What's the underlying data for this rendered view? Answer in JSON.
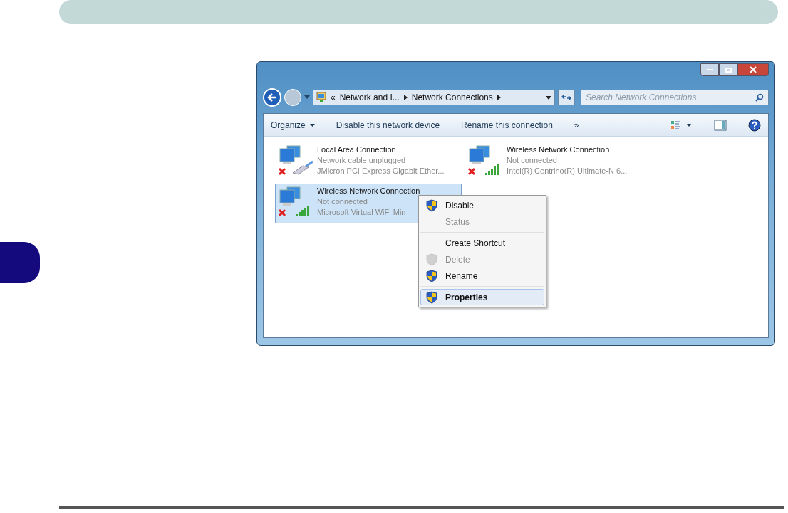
{
  "window": {
    "nav": {
      "breadcrumb": [
        "«",
        "Network and I...",
        "Network Connections"
      ]
    },
    "search": {
      "placeholder": "Search Network Connections"
    },
    "toolbar": [
      {
        "label": "Organize",
        "kind": "menu"
      },
      {
        "label": "Disable this network device",
        "kind": "plain"
      },
      {
        "label": "Rename this connection",
        "kind": "plain"
      },
      {
        "label": "»",
        "kind": "plain"
      }
    ],
    "connections": [
      {
        "name": "Local Area Connection",
        "status": "Network cable unplugged",
        "device": "JMicron PCI Express Gigabit Ether...",
        "kind": "ethernet",
        "selected": false
      },
      {
        "name": "Wireless Network Connection",
        "status": "Not connected",
        "device": "Intel(R) Centrino(R) Ultimate-N 6...",
        "kind": "wireless",
        "selected": false
      },
      {
        "name": "Wireless Network Connection",
        "status": "Not connected",
        "device": "Microsoft Virtual WiFi Min",
        "kind": "wireless",
        "selected": true
      }
    ],
    "context_menu": [
      [
        {
          "label": "Disable",
          "kind": "shield",
          "disabled": false,
          "default": false,
          "selected": false
        },
        {
          "label": "Status",
          "kind": "plain",
          "disabled": true,
          "default": false,
          "selected": false
        }
      ],
      [
        {
          "label": "Create Shortcut",
          "kind": "plain",
          "disabled": false,
          "default": false,
          "selected": false
        },
        {
          "label": "Delete",
          "kind": "shield",
          "disabled": true,
          "default": false,
          "selected": false
        },
        {
          "label": "Rename",
          "kind": "shield",
          "disabled": false,
          "default": false,
          "selected": false
        }
      ],
      [
        {
          "label": "Properties",
          "kind": "shield",
          "disabled": false,
          "default": true,
          "selected": true
        }
      ]
    ]
  }
}
